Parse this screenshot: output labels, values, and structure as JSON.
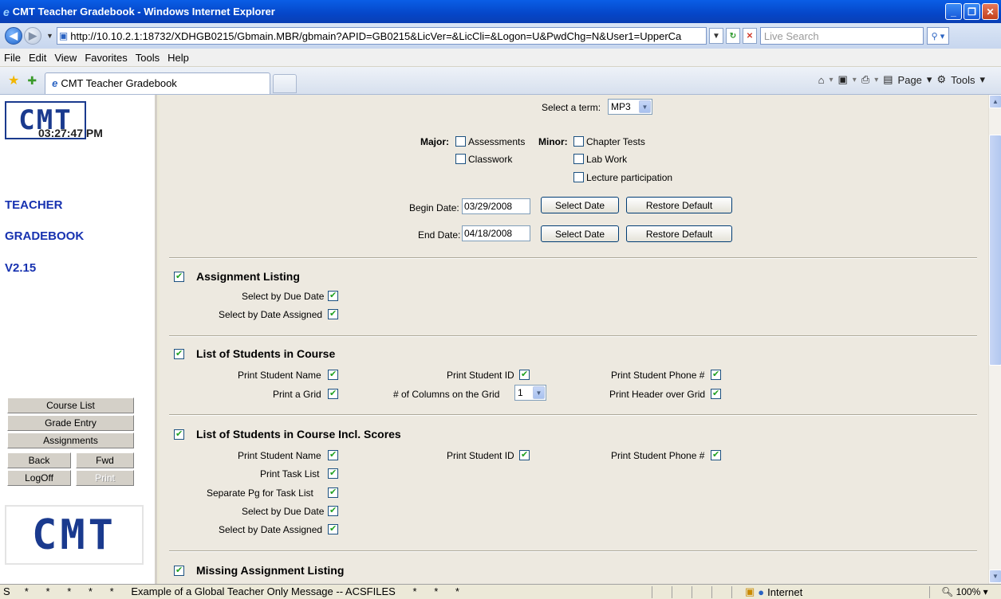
{
  "window": {
    "title": "CMT Teacher Gradebook - Windows Internet Explorer",
    "url": "http://10.10.2.1:18732/XDHGB0215/Gbmain.MBR/gbmain?APID=GB0215&LicVer=&LicCli=&Logon=U&PwdChg=N&User1=UpperCa",
    "search_placeholder": "Live Search"
  },
  "menu": [
    "File",
    "Edit",
    "View",
    "Favorites",
    "Tools",
    "Help"
  ],
  "tab": {
    "label": "CMT Teacher Gradebook"
  },
  "toolbar": {
    "page": "Page",
    "tools": "Tools"
  },
  "sidebar": {
    "logo": "CMT",
    "clock": "03:27:47 PM",
    "title1": "TEACHER",
    "title2": "GRADEBOOK",
    "version": "V2.15",
    "buttons": {
      "course_list": "Course List",
      "grade_entry": "Grade Entry",
      "assignments": "Assignments",
      "back": "Back",
      "fwd": "Fwd",
      "logoff": "LogOff",
      "print": "Print"
    }
  },
  "filters": {
    "term_label": "Select a term:",
    "term_value": "MP3",
    "major_label": "Major:",
    "minor_label": "Minor:",
    "major_items": [
      "Assessments",
      "Classwork"
    ],
    "minor_items": [
      "Chapter Tests",
      "Lab Work",
      "Lecture participation"
    ],
    "begin_label": "Begin Date:",
    "begin_value": "03/29/2008",
    "end_label": "End Date:",
    "end_value": "04/18/2008",
    "select_date": "Select Date",
    "restore_default": "Restore Default"
  },
  "sections": {
    "assignment_listing": {
      "title": "Assignment Listing",
      "by_due": "Select by Due Date",
      "by_assigned": "Select by Date Assigned"
    },
    "students": {
      "title": "List of Students in Course",
      "name": "Print Student Name",
      "id": "Print Student ID",
      "phone": "Print Student Phone #",
      "grid": "Print a Grid",
      "columns": "# of Columns on the Grid",
      "columns_value": "1",
      "header": "Print Header over Grid"
    },
    "students_scores": {
      "title": "List of Students in Course Incl. Scores",
      "name": "Print Student Name",
      "id": "Print Student ID",
      "phone": "Print Student Phone #",
      "task_list": "Print Task List",
      "separate_pg": "Separate Pg for Task List",
      "by_due": "Select by Due Date",
      "by_assigned": "Select by Date Assigned"
    },
    "missing": {
      "title": "Missing Assignment Listing"
    }
  },
  "status": {
    "message": "S     *      *      *      *      *      Example of a Global Teacher Only Message -- ACSFILES      *      *      *",
    "zone": "Internet",
    "zoom": "100%"
  }
}
